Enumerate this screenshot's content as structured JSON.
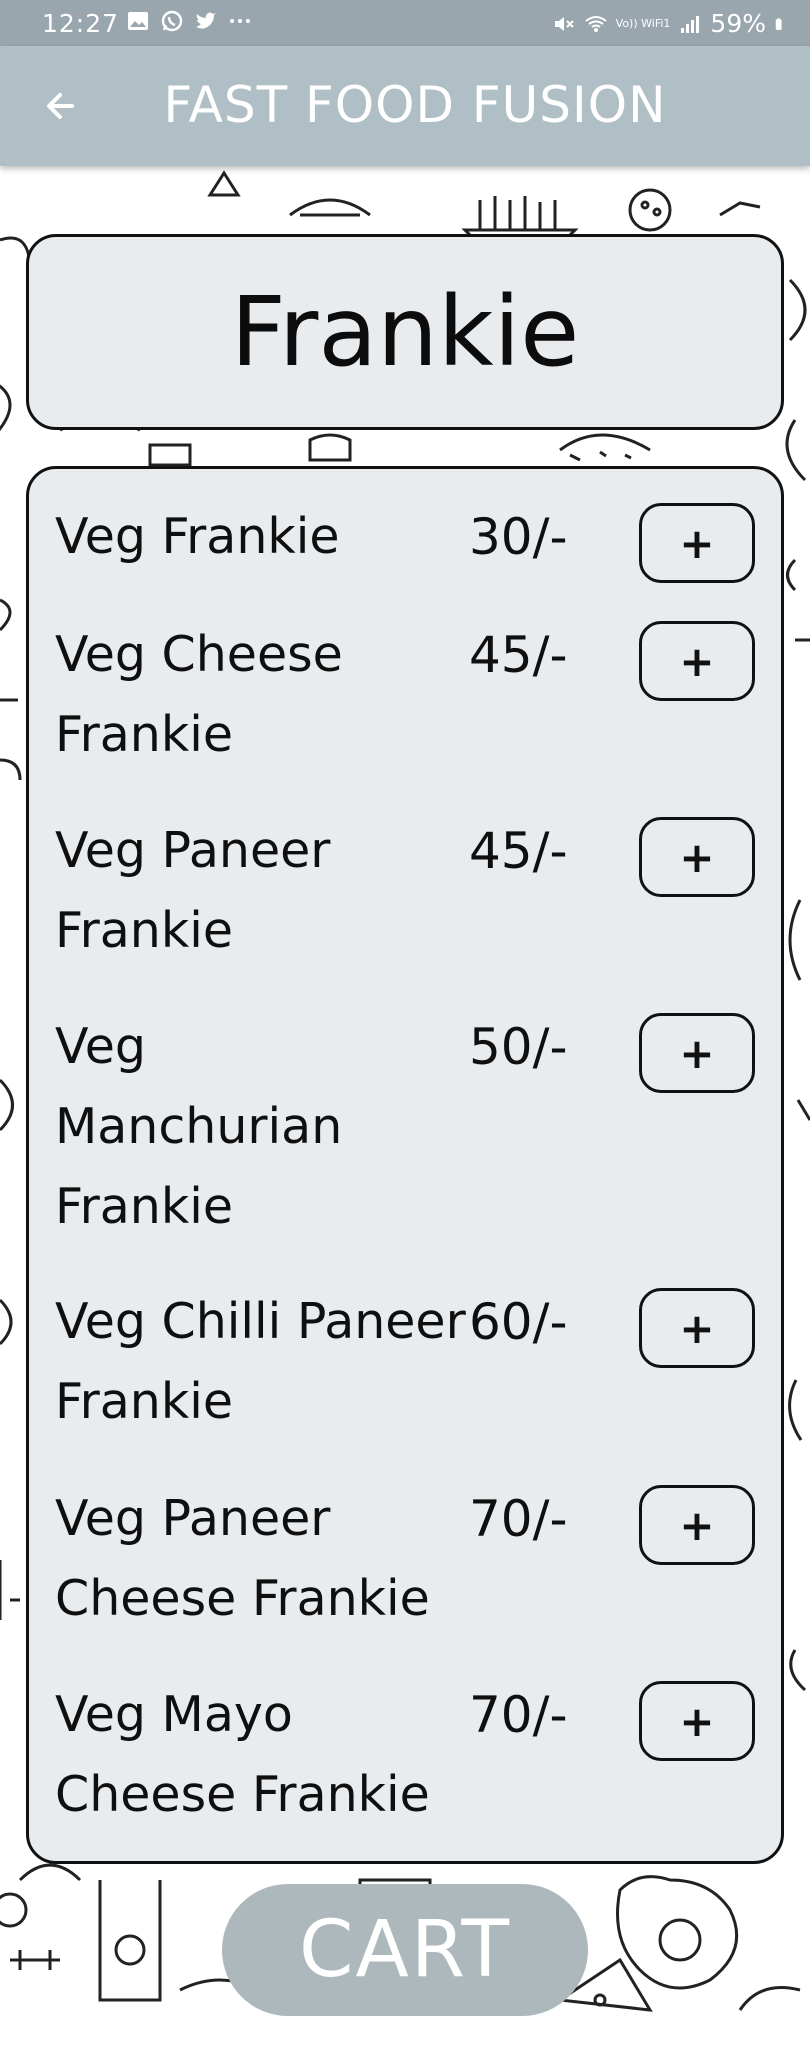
{
  "status_bar": {
    "time": "12:27",
    "left_icons": [
      "image-icon",
      "whatsapp-icon",
      "twitter-icon",
      "more-dots-icon"
    ],
    "right_icons": [
      "mute-icon",
      "wifi-icon",
      "signal-icon",
      "battery-icon"
    ],
    "network_label": "Vo)) WiFi1",
    "battery": "59%"
  },
  "toolbar": {
    "title": "FAST FOOD FUSION",
    "back_icon": "back-arrow-icon"
  },
  "category": {
    "title": "Frankie"
  },
  "menu": {
    "add_label": "+",
    "items": [
      {
        "name": "Veg Frankie",
        "price": "30/-"
      },
      {
        "name": "Veg Cheese Frankie",
        "price": "45/-"
      },
      {
        "name": "Veg Paneer Frankie",
        "price": "45/-"
      },
      {
        "name": "Veg Manchurian Frankie",
        "price": "50/-"
      },
      {
        "name": "Veg Chilli Paneer Frankie",
        "price": "60/-"
      },
      {
        "name": "Veg Paneer Cheese Frankie",
        "price": "70/-"
      },
      {
        "name": "Veg Mayo Cheese Frankie",
        "price": "70/-"
      }
    ]
  },
  "cart": {
    "label": "CART"
  },
  "colors": {
    "status_bar": "#9aa6ad",
    "toolbar": "#b0bfc5",
    "card": "#e9ecef",
    "cart_button": "#adb8bd"
  }
}
